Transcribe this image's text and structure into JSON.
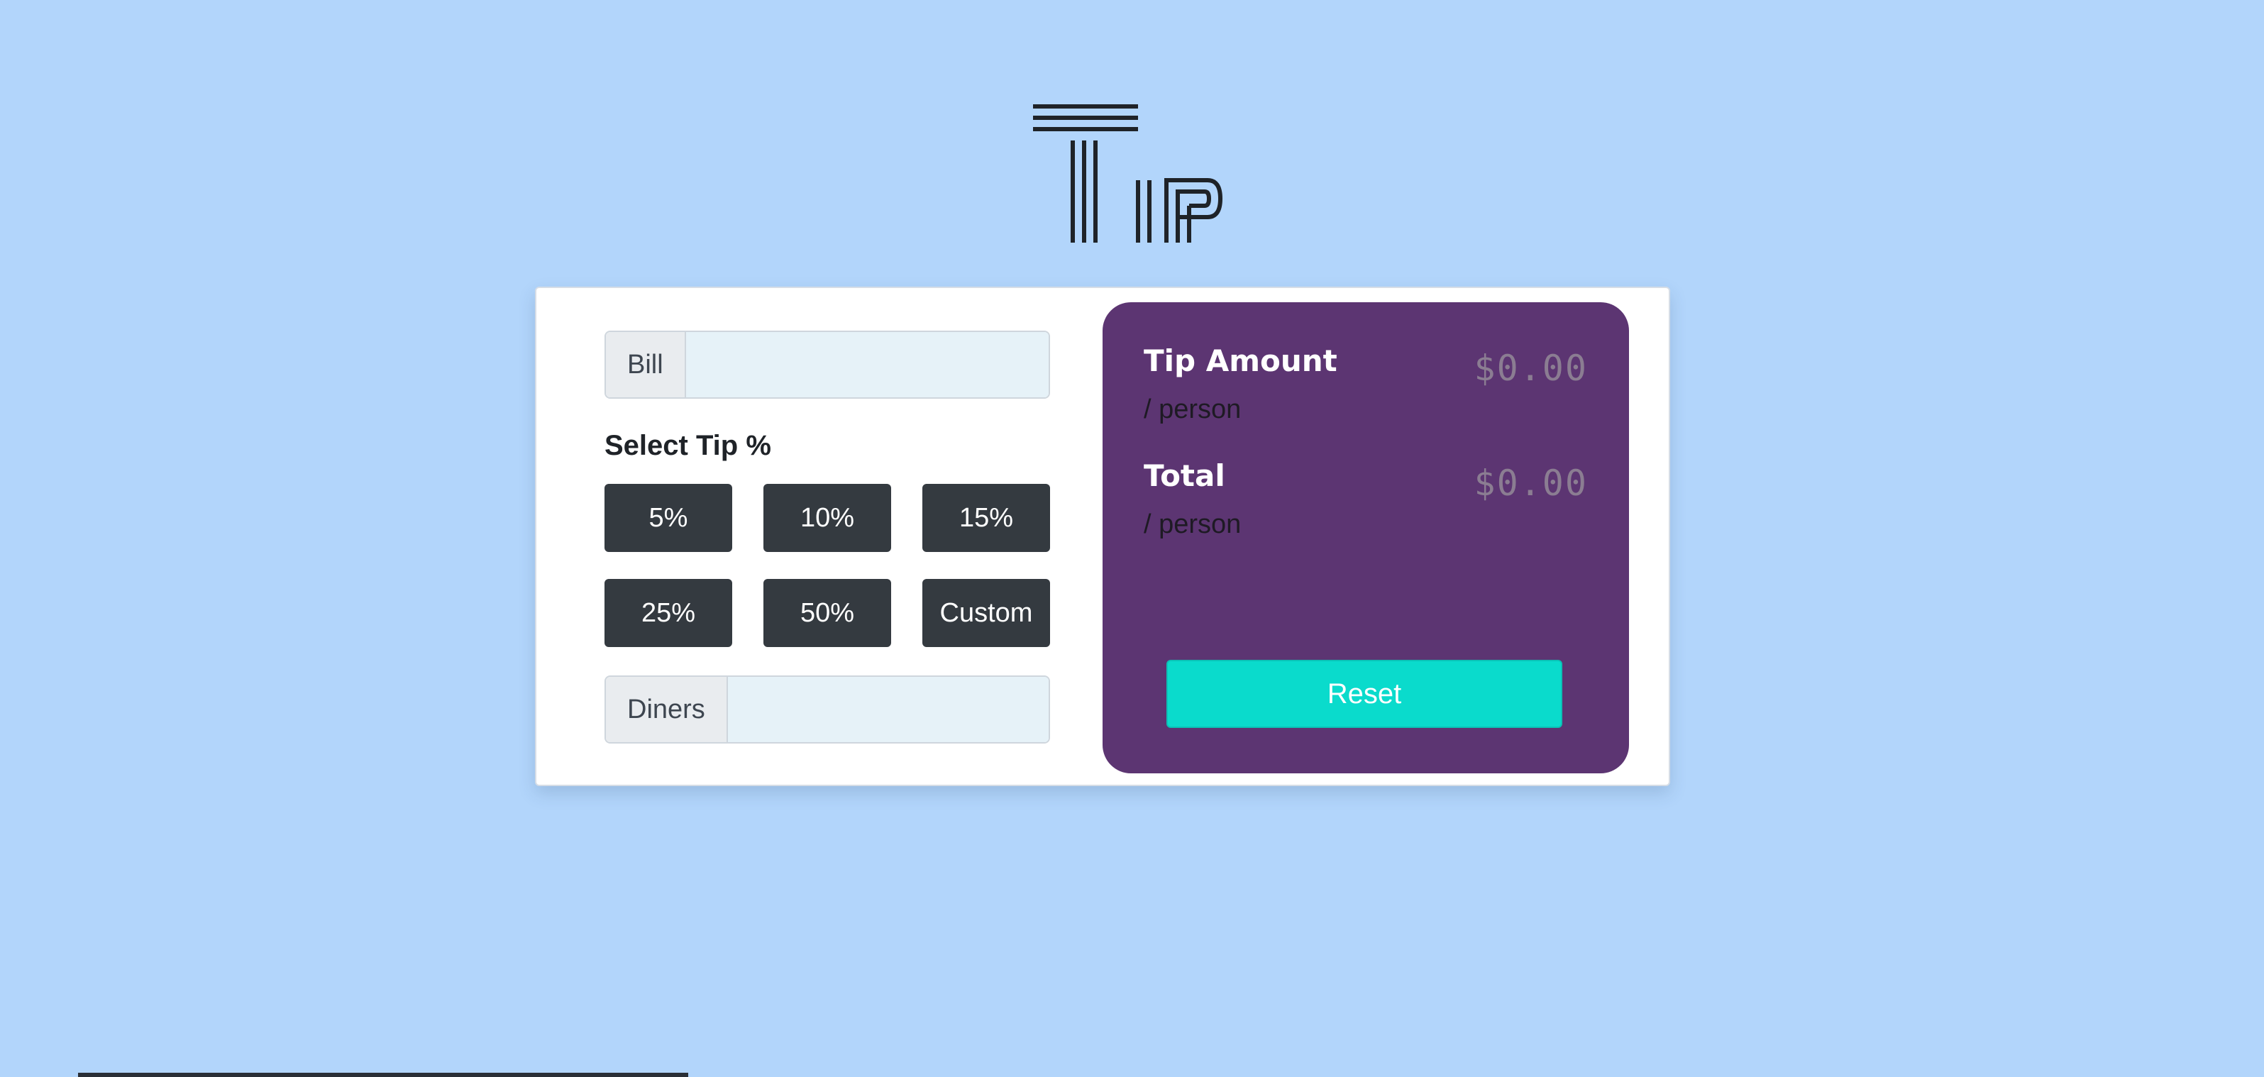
{
  "logo": {
    "icon": "tip-logo-icon",
    "alt_text": "Tip"
  },
  "bill": {
    "label": "Bill",
    "value": "",
    "placeholder": ""
  },
  "tip_select": {
    "heading": "Select Tip %",
    "options": [
      "5%",
      "10%",
      "15%",
      "25%",
      "50%",
      "Custom"
    ]
  },
  "diners": {
    "label": "Diners",
    "value": "",
    "placeholder": ""
  },
  "results": {
    "tip_amount_label": "Tip Amount",
    "tip_amount_sub": "/ person",
    "tip_amount_value": "$0.00",
    "total_label": "Total",
    "total_sub": "/ person",
    "total_value": "$0.00",
    "reset_label": "Reset"
  },
  "colors": {
    "background": "#b2d5fb",
    "panel": "#5c3572",
    "button_dark": "#343a40",
    "reset_button": "#0adbcc",
    "input_bg": "#e6f2f8"
  }
}
